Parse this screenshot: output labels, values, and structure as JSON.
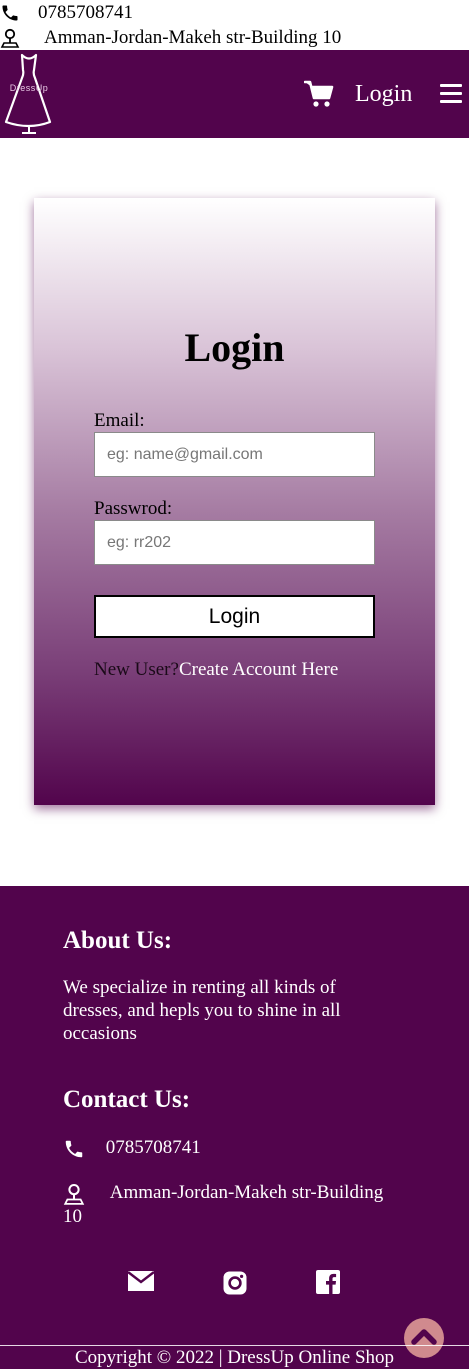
{
  "topbar": {
    "phone": "0785708741",
    "address": "Amman-Jordan-Makeh str-Building 10",
    "phone_icon": "phone-icon",
    "address_icon": "location-pin-icon"
  },
  "header": {
    "logo_text": "DressUp",
    "cart_icon": "cart-icon",
    "login_label": "Login",
    "menu_icon": "hamburger-menu-icon",
    "background_color": "#52044c"
  },
  "login_form": {
    "title": "Login",
    "email_label": "Email:",
    "email_placeholder": "eg: name@gmail.com",
    "password_label": "Passwrod:",
    "password_placeholder": "eg: rr202",
    "submit_label": "Login",
    "new_user_text": "New User?",
    "create_account_link": "Create Account Here"
  },
  "footer": {
    "about_heading": "About Us:",
    "about_text": "We specialize in renting all kinds of dresses, and hepls you to shine in all occasions",
    "contact_heading": "Contact Us:",
    "contact_phone": "0785708741",
    "contact_address": "Amman-Jordan-Makeh str-Building 10",
    "social_icons": [
      "email-icon",
      "instagram-icon",
      "facebook-icon"
    ],
    "scroll_top_icon": "chevron-up-icon",
    "copyright": "Copyright © 2022 | DressUp Online Shop",
    "accent_color": "#d08a8e"
  }
}
